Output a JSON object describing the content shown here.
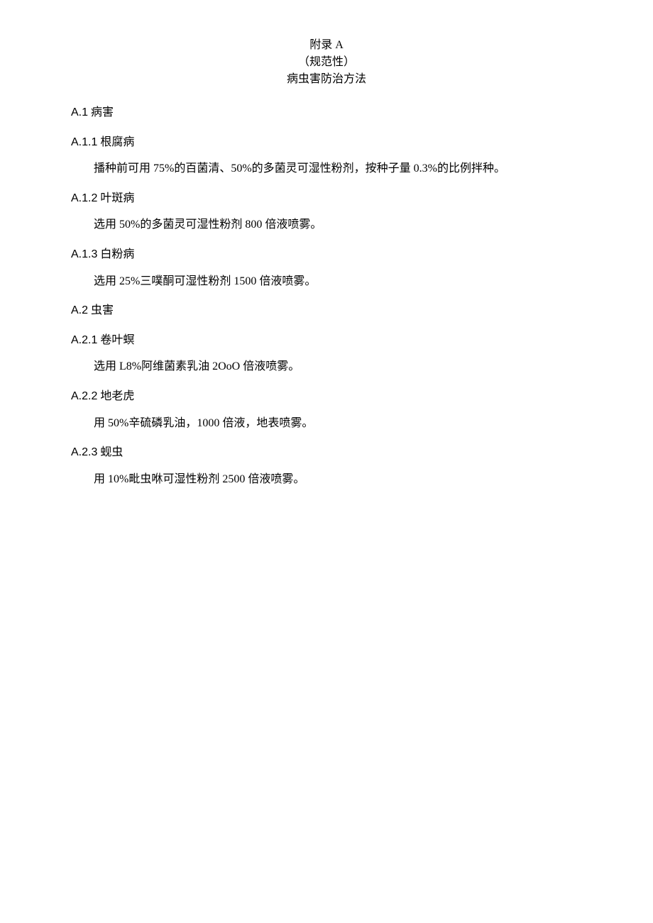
{
  "header": {
    "line1_latin": "附录 A",
    "line2": "（规范性）",
    "line3": "病虫害防治方法"
  },
  "sections": {
    "a1": {
      "num": "A.1",
      "title": " 病害"
    },
    "a11": {
      "num": "A.1.1",
      "title": " 根腐病",
      "body": "播种前可用 75%的百菌清、50%的多菌灵可湿性粉剂，按种子量 0.3%的比例拌种。"
    },
    "a12": {
      "num": "A.1.2",
      "title": " 叶斑病",
      "body": "选用 50%的多菌灵可湿性粉剂 800 倍液喷雾。"
    },
    "a13": {
      "num": "A.1.3",
      "title": " 白粉病",
      "body": "选用 25%三噗酮可湿性粉剂 1500 倍液喷雾。"
    },
    "a2": {
      "num": "A.2",
      "title": " 虫害"
    },
    "a21": {
      "num": "A.2.1",
      "title": " 卷叶螟",
      "body": "选用 L8%阿维菌素乳油 2OoO 倍液喷雾。"
    },
    "a22": {
      "num": "A.2.2",
      "title": " 地老虎",
      "body": "用 50%辛硫磷乳油，1000 倍液，地表喷雾。"
    },
    "a23": {
      "num": "A.2.3",
      "title": " 蚬虫",
      "body": "用 10%毗虫咻可湿性粉剂 2500 倍液喷雾。"
    }
  }
}
